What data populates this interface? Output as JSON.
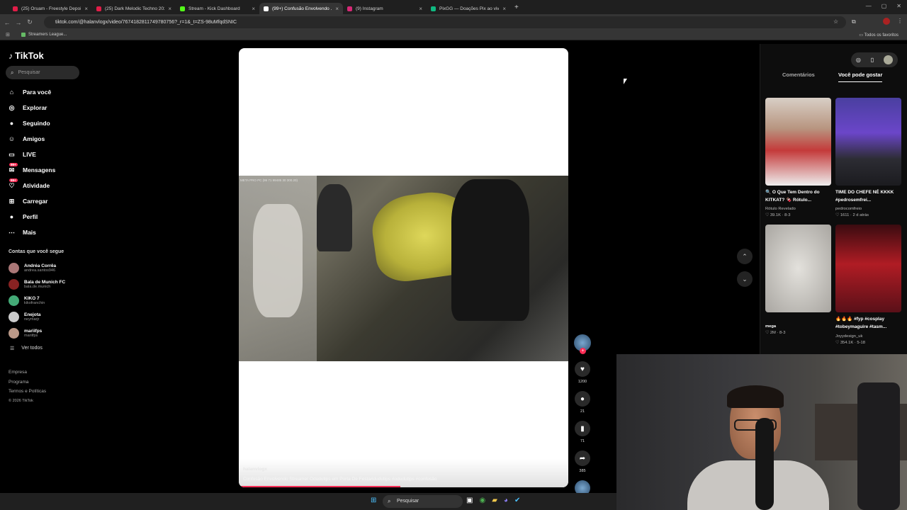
{
  "browser": {
    "tabs": [
      {
        "label": "(25) Oruam - Freestyle Depois ...",
        "color": "#e11d48",
        "active": false
      },
      {
        "label": "(25) Dark Melodic Techno 2026...",
        "color": "#e11d48",
        "active": false
      },
      {
        "label": "Stream - Kick Dashboard",
        "color": "#53fc18",
        "active": false
      },
      {
        "label": "(99+) Confusão Envolvendo ...",
        "color": "#ffffff",
        "active": true
      },
      {
        "label": "(9) Instagram",
        "color": "#d62976",
        "active": false
      },
      {
        "label": "PixGG — Doações Pix ao vivo p...",
        "color": "#10b981",
        "active": false
      }
    ],
    "url": "tiktok.com/@halanvlogx/video/7674182811749780756?_r=1&_t=ZS-98uMfqdSNIC",
    "bookmark": "Streamers League...",
    "all_favorites": "Todos os favoritos"
  },
  "sidebar": {
    "logo": "TikTok",
    "search_placeholder": "Pesquisar",
    "nav": [
      {
        "label": "Para você",
        "icon": "home-icon",
        "glyph": "⌂"
      },
      {
        "label": "Explorar",
        "icon": "compass-icon",
        "glyph": "◎"
      },
      {
        "label": "Seguindo",
        "icon": "following-icon",
        "glyph": "●"
      },
      {
        "label": "Amigos",
        "icon": "friends-icon",
        "glyph": "☺"
      },
      {
        "label": "LIVE",
        "icon": "live-icon",
        "glyph": "▭"
      },
      {
        "label": "Mensagens",
        "icon": "messages-icon",
        "glyph": "✉",
        "badge": "99+"
      },
      {
        "label": "Atividade",
        "icon": "activity-icon",
        "glyph": "♡",
        "badge": "99+"
      },
      {
        "label": "Carregar",
        "icon": "upload-icon",
        "glyph": "⊞"
      },
      {
        "label": "Perfil",
        "icon": "profile-icon",
        "glyph": "●"
      },
      {
        "label": "Mais",
        "icon": "more-icon",
        "glyph": "⋯"
      }
    ],
    "following_title": "Contas que você segue",
    "following": [
      {
        "name": "Andréa Corrêa",
        "handle": "andrea.santos946",
        "color": "#a77"
      },
      {
        "name": "Bala de Munich FC",
        "handle": "bala.de.munich",
        "color": "#822"
      },
      {
        "name": "KIKO 7",
        "handle": "kikofranchin",
        "color": "#4a7"
      },
      {
        "name": "Enejota",
        "handle": "neymarjr",
        "color": "#ccc"
      },
      {
        "name": "mariifps",
        "handle": "mariifps",
        "color": "#b98"
      }
    ],
    "see_all": "Ver todos",
    "footer": [
      "Empresa",
      "Programa",
      "Termos e Políticas"
    ],
    "copyright": "© 2026 TikTok"
  },
  "video": {
    "watermark": "META PRO PC (95 71 99485 30 300.20)",
    "username": "halanvlogx",
    "caption": "Confusão Envolvendo Streamer Odudutips em Porta De Festa#dudutips #odudutips #confusão",
    "progress": 0.49
  },
  "actions": {
    "likes": "1200",
    "comments": "21",
    "saves": "71",
    "shares": "385"
  },
  "right_panel": {
    "tabs": [
      "Comentários",
      "Você pode gostar"
    ],
    "active_tab": 1,
    "videos": [
      {
        "title": "🔍 O Que Tem Dentro do KITKAT? 🍫 Rótulo...",
        "author": "Rótulo Revelado",
        "likes": "39.1K",
        "date": "8-3"
      },
      {
        "title": "TIME DO CHEFE NÉ KKKK #pedrosemfrei...",
        "author": "pedrocomfreio",
        "likes": "1611",
        "date": "2 d atrás"
      },
      {
        "title": "",
        "author": "mega",
        "likes": "2M",
        "date": "8-3"
      },
      {
        "title": "🔥🔥🔥 #fyp #cosplay #tobeymaguire #tasm...",
        "author": "Joyydesign_uk",
        "likes": "354.1K",
        "date": "5-18"
      }
    ]
  },
  "taskbar": {
    "search": "Pesquisar"
  },
  "colors": {
    "accent": "#fe2c55",
    "bg": "#000000"
  }
}
